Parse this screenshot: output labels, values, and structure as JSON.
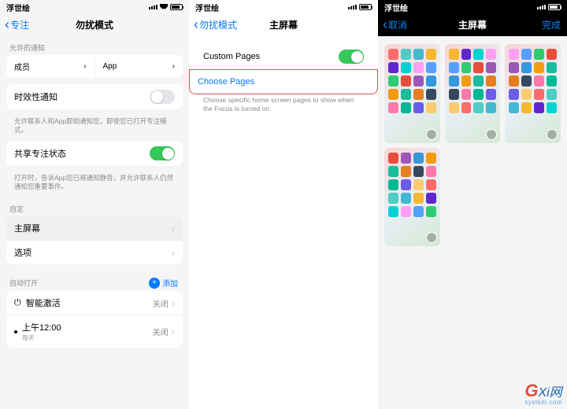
{
  "phone1": {
    "top_title": "浮世绘",
    "back": "专注",
    "title": "勿扰模式",
    "allowed_label": "允许的通知",
    "members": "成员",
    "app": "App",
    "time_sensitive": "时效性通知",
    "time_sensitive_desc": "允许联系人和App即刻通知您，即使您已打开专注模式。",
    "share_status": "共享专注状态",
    "share_desc": "打开时，告诉App您已将通知静音，并允许联系人仍然通知您重要事件。",
    "custom_label": "自定",
    "home_screen": "主屏幕",
    "options": "选项",
    "auto_label": "自动打开",
    "add": "添加",
    "smart_activate": "智能激活",
    "closed": "关闭",
    "time": "上午12:00",
    "time_sub": "每天"
  },
  "phone2": {
    "top_title": "浮世绘",
    "back": "勿扰模式",
    "title": "主屏幕",
    "custom_pages": "Custom Pages",
    "choose_pages": "Choose Pages",
    "desc": "Choose specific home screen pages to show when the Focus is turned on."
  },
  "phone3": {
    "top_title": "浮世绘",
    "cancel": "取消",
    "title": "主屏幕",
    "done": "完成"
  },
  "watermark": {
    "brand": "Xi网",
    "sub": "system.com"
  },
  "icon_colors": [
    "#ff6b6b",
    "#4ecdc4",
    "#45b7d1",
    "#f7b731",
    "#5f27cd",
    "#00d2d3",
    "#ff9ff3",
    "#54a0ff",
    "#2ecc71",
    "#e74c3c",
    "#9b59b6",
    "#3498db",
    "#f39c12",
    "#1abc9c",
    "#e67e22",
    "#34495e",
    "#fd79a8",
    "#00b894",
    "#6c5ce7",
    "#fdcb6e"
  ]
}
